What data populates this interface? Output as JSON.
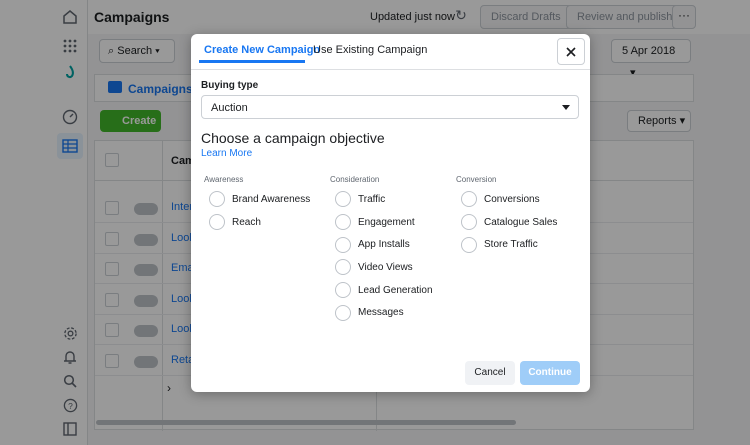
{
  "app": {
    "title": "Campaigns",
    "updated": "Updated just now",
    "discard": "Discard Drafts",
    "review": "Review and publish",
    "search": "Search",
    "date": "5 Apr 2018",
    "campaigns_tab": "Campaigns",
    "create": "Create",
    "reports": "Reports",
    "col_name": "Cam",
    "rows": [
      "Inter",
      "Look",
      "Emai",
      "Look",
      "Look",
      "Reta"
    ]
  },
  "modal": {
    "tabs": [
      "Create New Campaign",
      "Use Existing Campaign"
    ],
    "buying_type_label": "Buying type",
    "buying_type_value": "Auction",
    "heading": "Choose a campaign objective",
    "learn_more": "Learn More",
    "groups": [
      {
        "title": "Awareness",
        "options": [
          "Brand Awareness",
          "Reach"
        ]
      },
      {
        "title": "Consideration",
        "options": [
          "Traffic",
          "Engagement",
          "App Installs",
          "Video Views",
          "Lead Generation",
          "Messages"
        ]
      },
      {
        "title": "Conversion",
        "options": [
          "Conversions",
          "Catalogue Sales",
          "Store Traffic"
        ]
      }
    ],
    "cancel": "Cancel",
    "continue": "Continue"
  }
}
